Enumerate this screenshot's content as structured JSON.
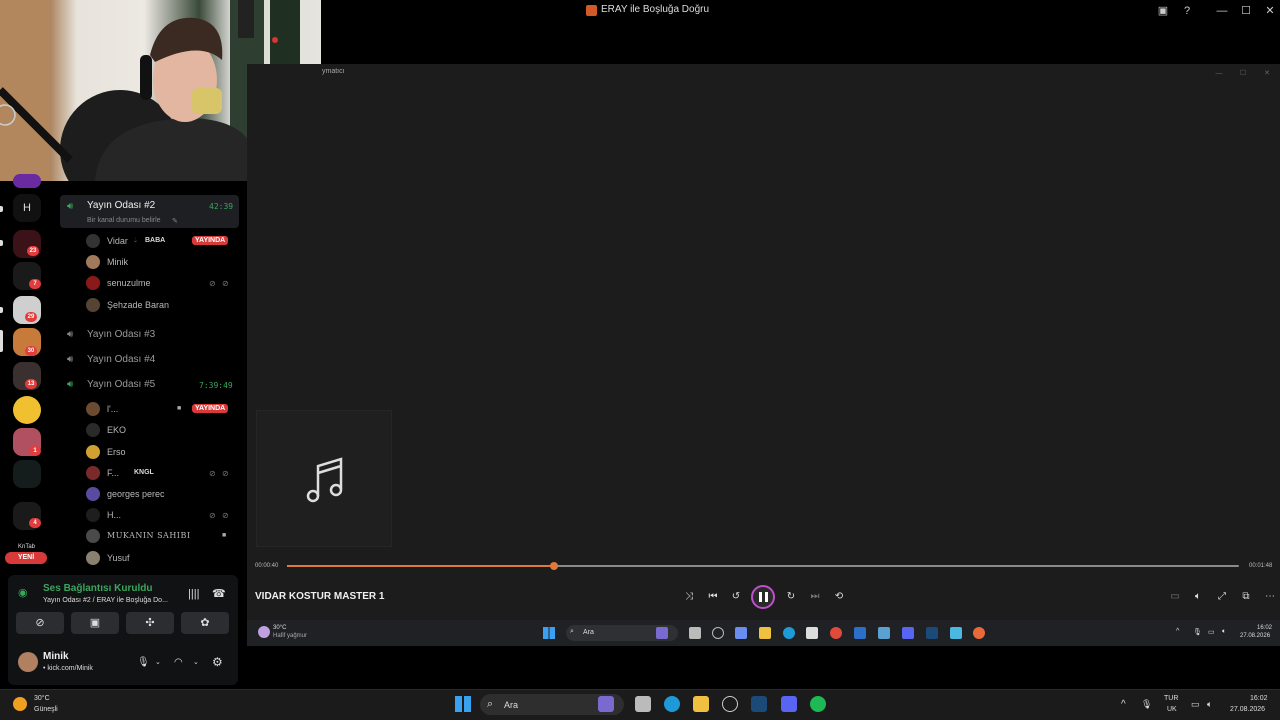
{
  "window": {
    "title": "ERAY ile Boşluğa Doğru"
  },
  "player": {
    "header_label": "ymatıcı",
    "time_current": "00:00:40",
    "time_total": "00:01:48",
    "progress_fraction": 0.28,
    "track_title": "VIDAR KOSTUR MASTER 1",
    "accent_color": "#e07a3a",
    "art_icon": "music-note-icon"
  },
  "inner_taskbar": {
    "weather_temp": "30°C",
    "weather_desc": "Hafif yağmur",
    "search_placeholder": "Ara",
    "clock_time": "16:02",
    "clock_date": "27.08.2026"
  },
  "discord": {
    "server_letter": "H",
    "server_badges": [
      "23",
      "7",
      "29",
      "30",
      "13",
      "1",
      "4"
    ],
    "new_label": "YENİ",
    "server_text": "KnTab",
    "channels": {
      "yayin_2": {
        "name": "Yayın Odası #2",
        "timer": "42:39",
        "status": "Bir kanal durumu belirle"
      },
      "yayin_3": {
        "name": "Yayın Odası #3"
      },
      "yayin_4": {
        "name": "Yayın Odası #4"
      },
      "yayin_5": {
        "name": "Yayın Odası #5",
        "timer": "7:39:49"
      }
    },
    "members_room2": [
      {
        "name": "Vidar",
        "tag": "BABA",
        "live": "YAYINDA"
      },
      {
        "name": "Minik"
      },
      {
        "name": "senuzulme"
      },
      {
        "name": "Şehzade Baran"
      }
    ],
    "members_room5": [
      {
        "name": "l'...",
        "live": "YAYINDA"
      },
      {
        "name": "EKO"
      },
      {
        "name": "Erso"
      },
      {
        "name": "F...",
        "tag": "KNGL"
      },
      {
        "name": "georges perec"
      },
      {
        "name": "H..."
      },
      {
        "name": "MUKANIN SAHIBI"
      },
      {
        "name": "Yusuf"
      }
    ],
    "voice": {
      "status": "Ses Bağlantısı Kuruldu",
      "location": "Yayın Odası #2 / ERAY ile Boşluğa Do...",
      "status_color": "#3ba55c"
    },
    "user": {
      "name": "Minik",
      "subtitle": "• kick.com/Minik"
    }
  },
  "taskbar": {
    "weather_temp": "30°C",
    "weather_desc": "Güneşli",
    "search_placeholder": "Ara",
    "lang_1": "TUR",
    "lang_2": "UK",
    "clock_time": "16:02",
    "clock_date": "27.08.2026"
  }
}
